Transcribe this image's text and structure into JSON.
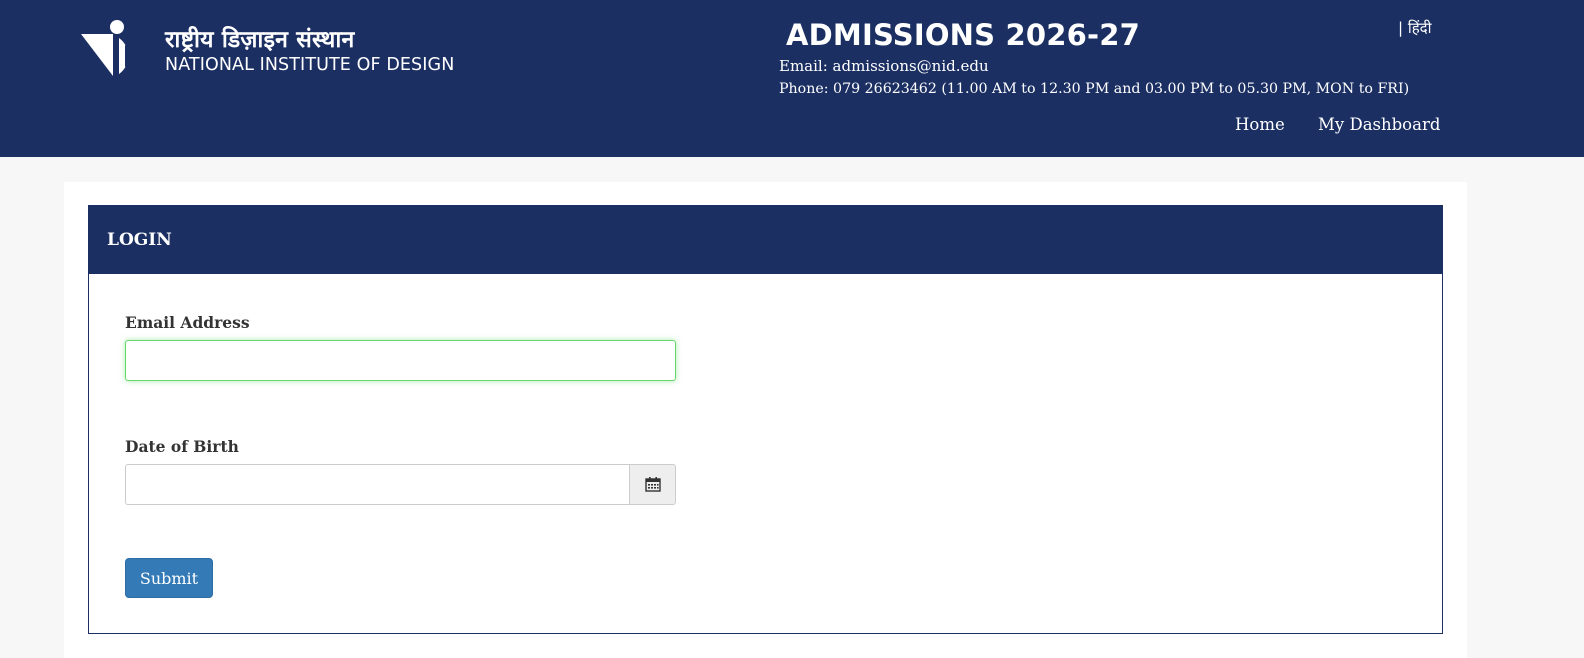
{
  "header": {
    "logo_hindi": "राष्ट्रीय डिज़ाइन संस्थान",
    "logo_english": "NATIONAL INSTITUTE OF DESIGN",
    "admissions_title": "ADMISSIONS 2026-27",
    "email_line": "Email: admissions@nid.edu",
    "phone_line": "Phone: 079 26623462 (11.00 AM to 12.30 PM and 03.00 PM to 05.30 PM, MON to FRI)",
    "language_link": "| हिंदी",
    "nav": {
      "home": "Home",
      "dashboard": "My Dashboard"
    },
    "colors": {
      "background": "#1b2f63",
      "text": "#ffffff"
    }
  },
  "login": {
    "panel_title": "LOGIN",
    "email_label": "Email Address",
    "email_value": "",
    "dob_label": "Date of Birth",
    "dob_value": "",
    "calendar_icon": "calendar-icon",
    "submit_label": "Submit",
    "colors": {
      "submit": "#337ab7",
      "focus_border": "#66d96a"
    }
  }
}
